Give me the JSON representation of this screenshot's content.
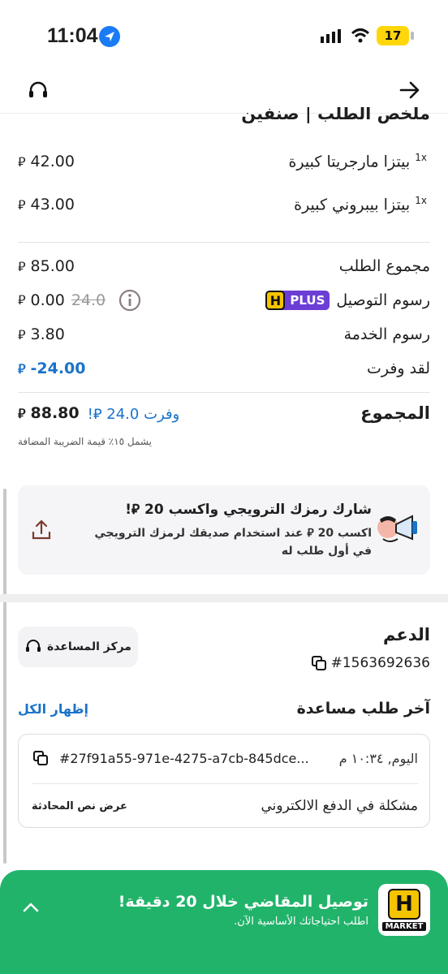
{
  "status_bar": {
    "time": "11:04",
    "battery": "17"
  },
  "header": {
    "support_icon": "headset-icon",
    "back_icon": "arrow-right-icon"
  },
  "order_summary": {
    "title": "ملخص الطلب | صنفين",
    "items": [
      {
        "qty": "1x",
        "name": "بيتزا مارجريتا كبيرة",
        "price": "42.00"
      },
      {
        "qty": "1x",
        "name": "بيتزا بيبروني كبيرة",
        "price": "43.00"
      }
    ],
    "currency": "⃁",
    "subtotal_label": "مجموع الطلب",
    "subtotal_value": "85.00",
    "delivery_label": "رسوم التوصيل",
    "delivery_badge_letter": "H",
    "delivery_badge_text": "PLUS",
    "delivery_old": "24.0",
    "delivery_value": "0.00",
    "service_label": "رسوم الخدمة",
    "service_value": "3.80",
    "saved_label": "لقد وفرت",
    "saved_value": "-24.00",
    "total_label": "المجموع",
    "total_saved": "وفرت 24.0 ⃁!",
    "total_value": "88.80",
    "vat_note": "يشمل ١٥٪ قيمة الضريبة المضافة"
  },
  "promo": {
    "title": "شارك رمزك الترويجي واكسب 20 ⃁!",
    "body": "اكسب 20 ⃁ عند استخدام صديقك لرمزك الترويجي في أول طلب له",
    "share_icon": "share-icon",
    "illustration": "megaphone-icon"
  },
  "support": {
    "title": "الدعم",
    "order_id": "#1563692636",
    "help_center": "مركز المساعدة",
    "recent_title": "آخر طلب مساعدة",
    "show_all": "إظهار الكل",
    "ticket": {
      "date": "اليوم, ١٠:٣٤ م",
      "id": "#27f91a55-971e-4275-a7cb-845dce...",
      "subject": "مشكلة في الدفع الالكتروني",
      "view_transcript": "عرض نص المحادثة"
    }
  },
  "banner": {
    "title": "توصيل المقاضي خلال 20 دقيقة!",
    "subtitle": "اطلب احتياجاتك الأساسية الآن.",
    "logo_letter": "H",
    "logo_text": "MARKET",
    "bg_color": "#22b36b"
  },
  "colors": {
    "accent_blue": "#1a73c9",
    "plus_purple": "#6b3fd6",
    "brand_yellow": "#f5c400"
  }
}
